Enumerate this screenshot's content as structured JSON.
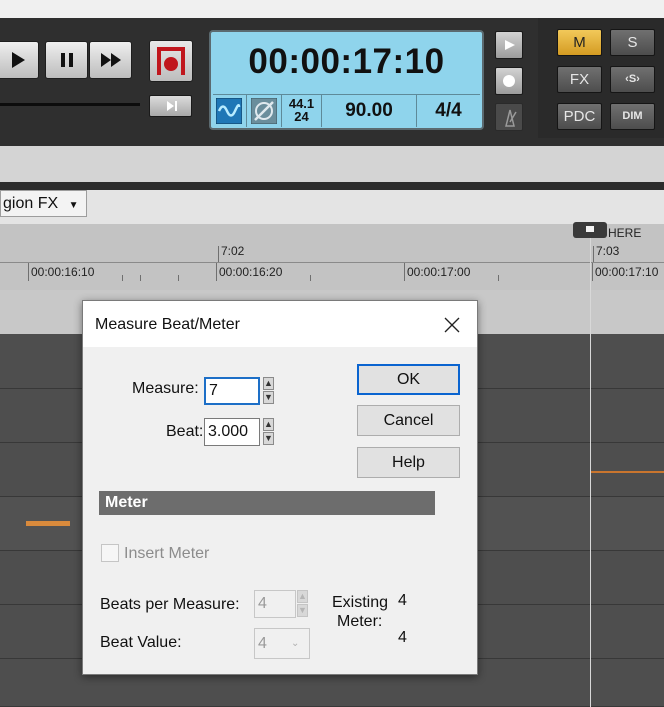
{
  "transport": {
    "time": "00:00:17:10",
    "sample_rate": "44.1",
    "bit_depth": "24",
    "tempo": "90.00",
    "meter": "4/4"
  },
  "mix_buttons": {
    "m": "M",
    "s": "S",
    "fx": "FX",
    "s_bus": "‹S›",
    "pdc": "PDC",
    "dim": "DIM"
  },
  "toolbar": {
    "region_fx": "gion FX"
  },
  "ruler": {
    "marker_label": "HERE",
    "measures": [
      "7:02",
      "7:03"
    ],
    "times": [
      "00:00:16:10",
      "00:00:16:20",
      "00:00:17:00",
      "00:00:17:10"
    ]
  },
  "dialog": {
    "title": "Measure Beat/Meter",
    "measure_label": "Measure:",
    "measure_value": "7",
    "beat_label": "Beat:",
    "beat_value": "3.000",
    "ok_label": "OK",
    "cancel_label": "Cancel",
    "help_label": "Help",
    "meter_section": "Meter",
    "insert_meter_label": "Insert Meter",
    "insert_meter_checked": false,
    "beats_per_measure_label": "Beats per Measure:",
    "beats_per_measure_value": "4",
    "beat_value_label": "Beat Value:",
    "beat_value_value": "4",
    "existing_meter_label_1": "Existing",
    "existing_meter_label_2": "Meter:",
    "existing_meter_top": "4",
    "existing_meter_bottom": "4"
  },
  "colors": {
    "lcd": "#8fd4ec",
    "accent_m": "#e2b53a",
    "orange_clip": "#d98a3c"
  }
}
